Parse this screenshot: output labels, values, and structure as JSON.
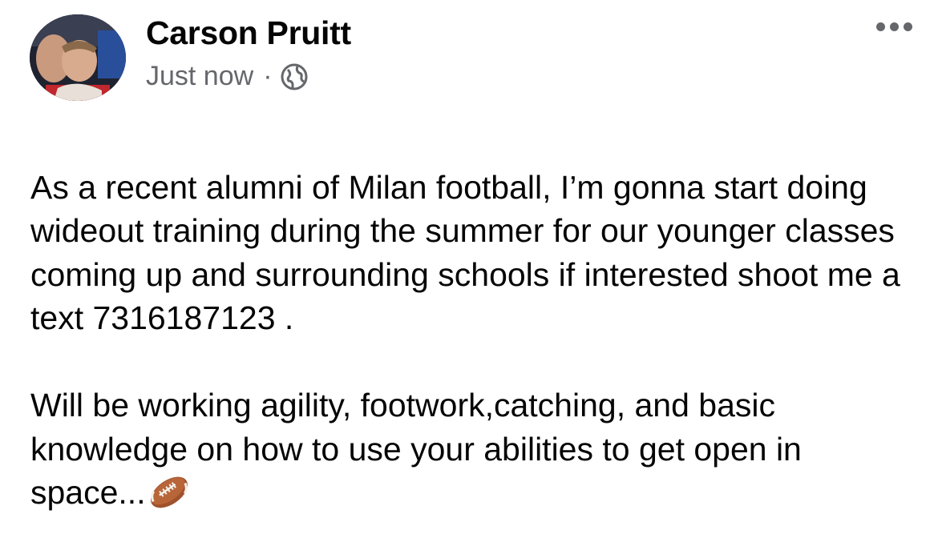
{
  "post": {
    "author": "Carson Pruitt",
    "timestamp": "Just now",
    "separator": "·",
    "privacy_icon": "globe-icon",
    "menu_icon": "more-options-icon",
    "paragraph1": "As a recent alumni of Milan football, I’m gonna start doing wideout training during the summer for our younger classes coming up and surrounding schools if interested shoot me a text 7316187123 .",
    "paragraph2": "Will be working agility, footwork,catching, and basic knowledge on how to use your abilities to get open in space...",
    "emoji_icon": "american-football-emoji"
  }
}
